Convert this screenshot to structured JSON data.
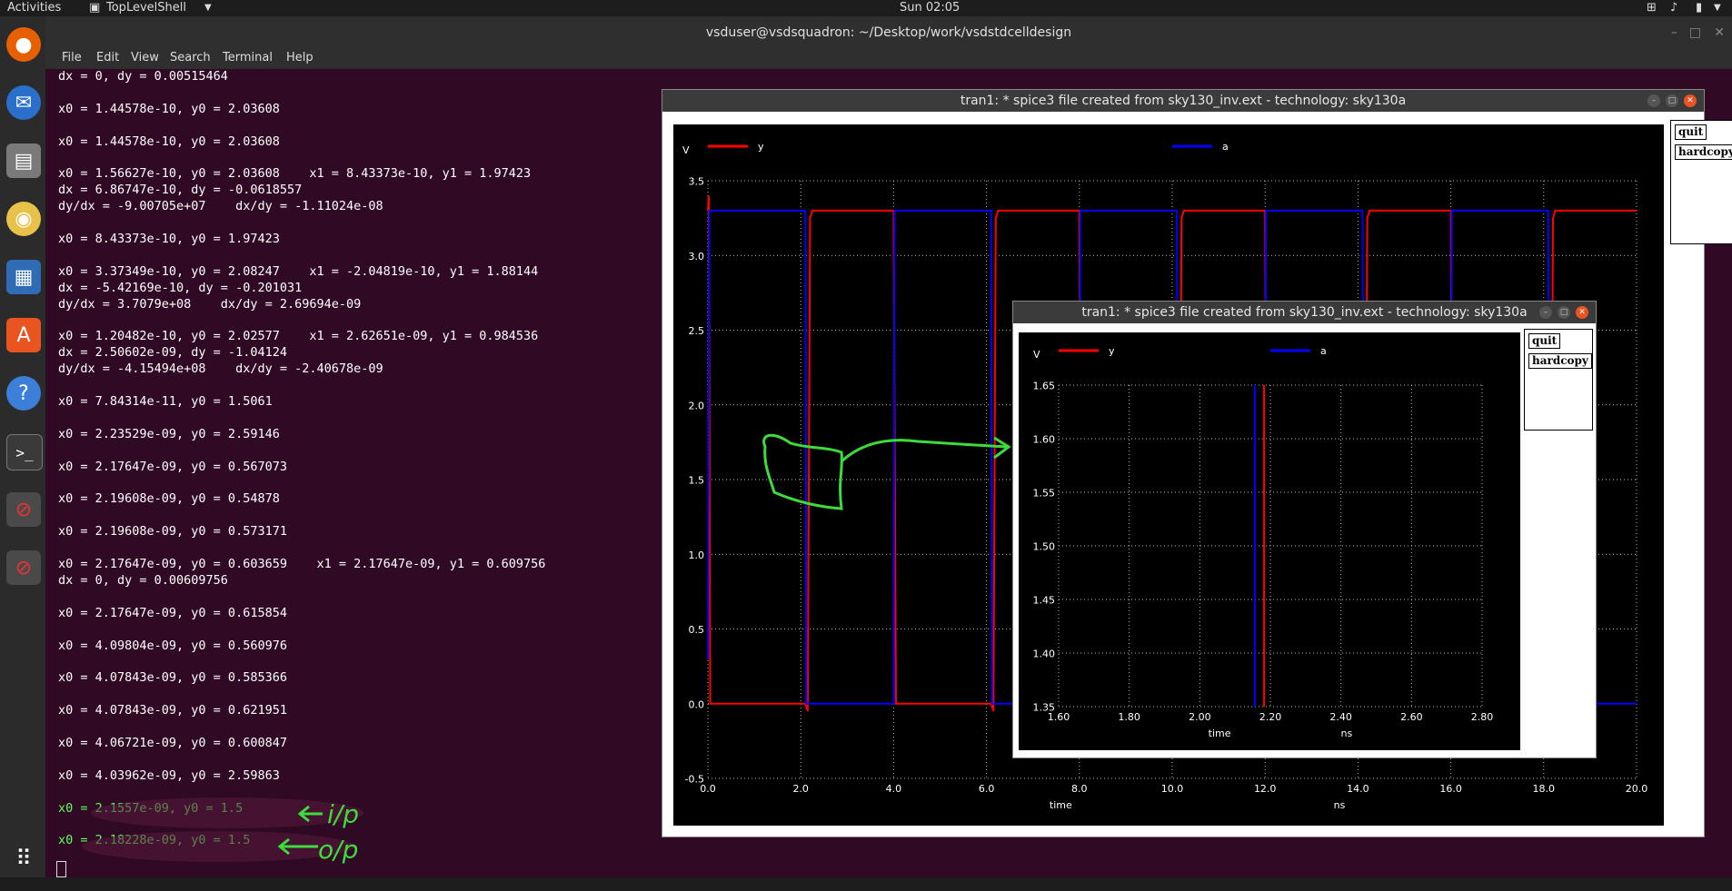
{
  "system": {
    "activities": "Activities",
    "app_menu": "TopLevelShell",
    "clock": "Sun 02:05"
  },
  "terminal": {
    "title": "vsduser@vsdsquadron: ~/Desktop/work/vsdstdcelldesign",
    "menu": [
      "File",
      "Edit",
      "View",
      "Search",
      "Terminal",
      "Help"
    ],
    "lines": [
      "dx = 0, dy = 0.00515464",
      "",
      "x0 = 1.44578e-10, y0 = 2.03608",
      "",
      "x0 = 1.44578e-10, y0 = 2.03608",
      "",
      "x0 = 1.56627e-10, y0 = 2.03608    x1 = 8.43373e-10, y1 = 1.97423",
      "dx = 6.86747e-10, dy = -0.0618557",
      "dy/dx = -9.00705e+07    dx/dy = -1.11024e-08",
      "",
      "x0 = 8.43373e-10, y0 = 1.97423",
      "",
      "x0 = 3.37349e-10, y0 = 2.08247    x1 = -2.04819e-10, y1 = 1.88144",
      "dx = -5.42169e-10, dy = -0.201031",
      "dy/dx = 3.7079e+08    dx/dy = 2.69694e-09",
      "",
      "x0 = 1.20482e-10, y0 = 2.02577    x1 = 2.62651e-09, y1 = 0.984536",
      "dx = 2.50602e-09, dy = -1.04124",
      "dy/dx = -4.15494e+08    dx/dy = -2.40678e-09",
      "",
      "x0 = 7.84314e-11, y0 = 1.5061",
      "",
      "x0 = 2.23529e-09, y0 = 2.59146",
      "",
      "x0 = 2.17647e-09, y0 = 0.567073",
      "",
      "x0 = 2.19608e-09, y0 = 0.54878",
      "",
      "x0 = 2.19608e-09, y0 = 0.573171",
      "",
      "x0 = 2.17647e-09, y0 = 0.603659    x1 = 2.17647e-09, y1 = 0.609756",
      "dx = 0, dy = 0.00609756",
      "",
      "x0 = 2.17647e-09, y0 = 0.615854",
      "",
      "x0 = 4.09804e-09, y0 = 0.560976",
      "",
      "x0 = 4.07843e-09, y0 = 0.585366",
      "",
      "x0 = 4.07843e-09, y0 = 0.621951",
      "",
      "x0 = 4.06721e-09, y0 = 0.600847",
      "",
      "x0 = 4.03962e-09, y0 = 2.59863",
      "",
      "x0 = 2.1557e-09, y0 = 1.5",
      "",
      "x0 = 2.18228e-09, y0 = 1.5"
    ],
    "annotation_ip": "i/p",
    "annotation_op": "o/p",
    "colors": {
      "bg": "#300a24",
      "text": "#ffffff",
      "highlight": "#5cff5c"
    }
  },
  "plot_main": {
    "title": "tran1: * spice3 file created from sky130_inv.ext - technology: sky130a",
    "buttons": {
      "quit": "quit",
      "hardcopy": "hardcopy"
    },
    "ylabel": "V",
    "xlabel": "time",
    "xunit": "ns",
    "legend": [
      {
        "name": "y",
        "color": "#ff0000"
      },
      {
        "name": "a",
        "color": "#0000ff"
      }
    ],
    "chart_data": {
      "type": "line",
      "xlim": [
        0.0,
        20.0
      ],
      "ylim": [
        -0.5,
        3.5
      ],
      "x_ticks": [
        "0.0",
        "2.0",
        "4.0",
        "6.0",
        "8.0",
        "10.0",
        "12.0",
        "14.0",
        "16.0",
        "18.0",
        "20.0"
      ],
      "y_ticks": [
        "-0.5",
        "0.0",
        "0.5",
        "1.0",
        "1.5",
        "2.0",
        "2.5",
        "3.0",
        "3.5"
      ],
      "grid": true,
      "series": [
        {
          "name": "y",
          "color": "#ff0000",
          "x": [
            0.0,
            0.02,
            0.05,
            2.1,
            2.15,
            2.2,
            2.25,
            4.0,
            4.05,
            4.1,
            6.1,
            6.15,
            6.2,
            6.25,
            8.0,
            8.05,
            8.1,
            10.1,
            10.15,
            10.2,
            10.25,
            12.0,
            12.05,
            12.1,
            14.1,
            14.15,
            14.2,
            14.25,
            16.0,
            16.05,
            16.1,
            18.1,
            18.15,
            18.2,
            18.25,
            20.0
          ],
          "y": [
            3.3,
            3.4,
            0.0,
            0.0,
            -0.05,
            3.25,
            3.3,
            3.3,
            0.0,
            0.0,
            0.0,
            -0.05,
            3.25,
            3.3,
            3.3,
            0.0,
            0.0,
            0.0,
            -0.05,
            3.25,
            3.3,
            3.3,
            0.0,
            0.0,
            0.0,
            -0.05,
            3.25,
            3.3,
            3.3,
            0.0,
            0.0,
            0.0,
            -0.05,
            3.25,
            3.3,
            3.3
          ]
        },
        {
          "name": "a",
          "color": "#0000ff",
          "x": [
            0.0,
            0.03,
            0.05,
            2.1,
            2.12,
            4.0,
            4.02,
            6.1,
            6.12,
            8.0,
            8.02,
            10.1,
            10.12,
            12.0,
            12.02,
            14.1,
            14.12,
            16.0,
            16.02,
            18.1,
            18.12,
            20.0
          ],
          "y": [
            0.3,
            3.3,
            3.3,
            3.3,
            0.0,
            0.0,
            3.3,
            3.3,
            0.0,
            0.0,
            3.3,
            3.3,
            0.0,
            0.0,
            3.3,
            3.3,
            0.0,
            0.0,
            3.3,
            3.3,
            0.0,
            0.0
          ]
        }
      ]
    }
  },
  "plot_zoom": {
    "title": "tran1: * spice3 file created from sky130_inv.ext - technology: sky130a",
    "buttons": {
      "quit": "quit",
      "hardcopy": "hardcopy"
    },
    "ylabel": "V",
    "xlabel": "time",
    "xunit": "ns",
    "legend": [
      {
        "name": "y",
        "color": "#ff0000"
      },
      {
        "name": "a",
        "color": "#0000ff"
      }
    ],
    "chart_data": {
      "type": "line",
      "xlim": [
        1.6,
        2.8
      ],
      "ylim": [
        1.35,
        1.65
      ],
      "x_ticks": [
        "1.60",
        "1.80",
        "2.00",
        "2.20",
        "2.40",
        "2.60",
        "2.80"
      ],
      "y_ticks": [
        "1.35",
        "1.40",
        "1.45",
        "1.50",
        "1.55",
        "1.60",
        "1.65"
      ],
      "grid": true,
      "series": [
        {
          "name": "y",
          "color": "#ff0000",
          "x": [
            2.182,
            2.182
          ],
          "y": [
            1.35,
            1.65
          ]
        },
        {
          "name": "a",
          "color": "#0000ff",
          "x": [
            2.156,
            2.156
          ],
          "y": [
            1.35,
            1.65
          ]
        }
      ]
    }
  }
}
